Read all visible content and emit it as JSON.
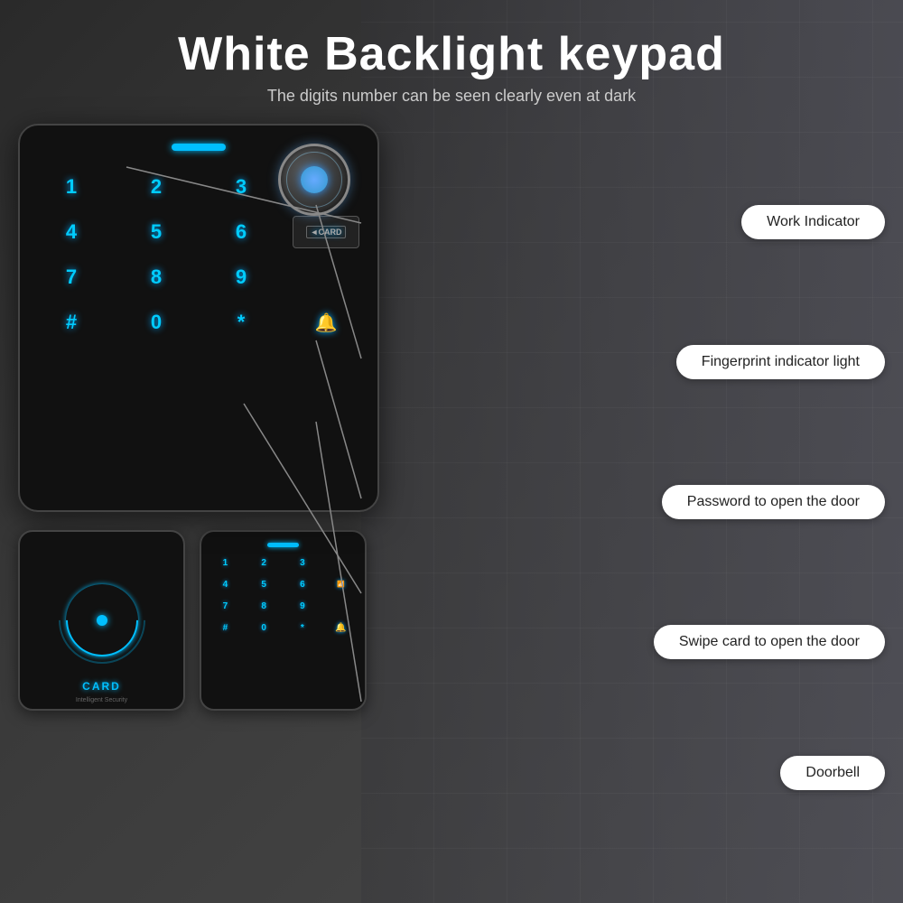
{
  "header": {
    "title": "White Backlight keypad",
    "subtitle": "The digits number can be seen clearly even at dark"
  },
  "keypad": {
    "keys": [
      "1",
      "2",
      "3",
      "",
      "4",
      "5",
      "6",
      "",
      "7",
      "8",
      "9",
      "CARD",
      "#",
      "0",
      "*",
      "BELL"
    ],
    "small_keys": [
      "1",
      "2",
      "3",
      "",
      "4",
      "5",
      "6",
      "",
      "7",
      "8",
      "9",
      "CARD",
      "#",
      "0",
      "*",
      "BELL"
    ]
  },
  "labels": {
    "work_indicator": "Work Indicator",
    "fingerprint": "Fingerprint indicator light",
    "password": "Password to open the door",
    "swipe_card": "Swipe card to open the door",
    "doorbell": "Doorbell"
  },
  "card_device": {
    "card_text": "CARD",
    "card_sub": "Intelligent Security"
  }
}
